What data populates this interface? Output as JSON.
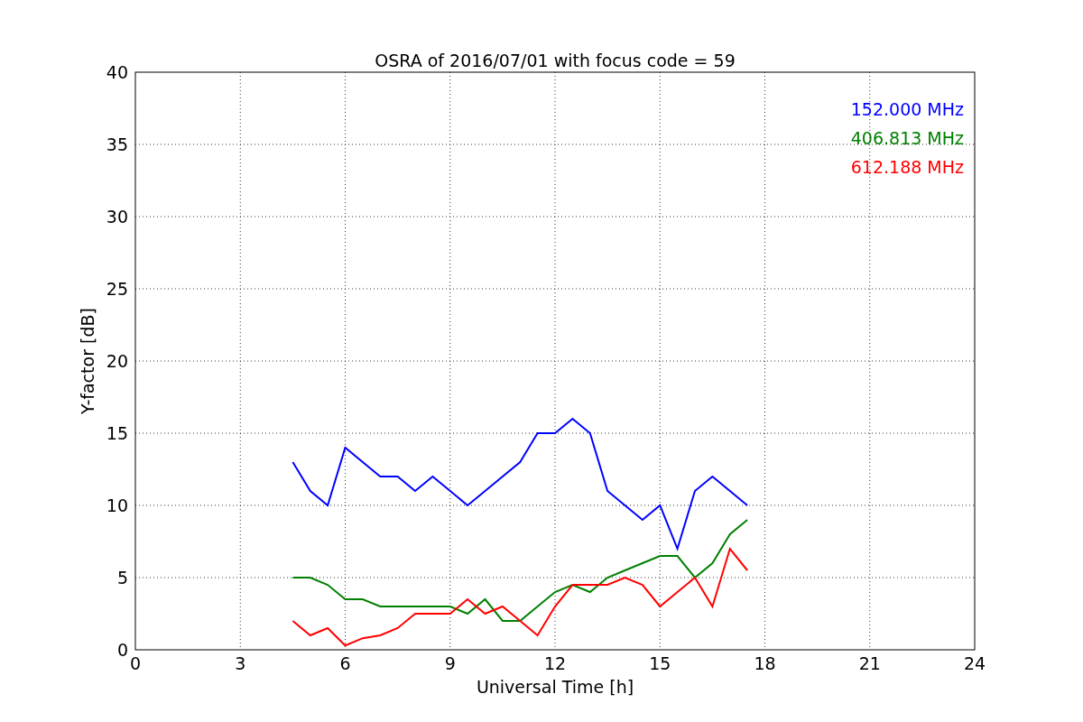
{
  "chart_data": {
    "type": "line",
    "title": "OSRA of 2016/07/01 with focus code = 59",
    "xlabel": "Universal Time [h]",
    "ylabel": "Y-factor [dB]",
    "x": [
      4.5,
      5,
      5.5,
      6,
      6.5,
      7,
      7.5,
      8,
      8.5,
      9,
      9.5,
      10,
      10.5,
      11,
      11.5,
      12,
      12.5,
      13,
      13.5,
      14,
      14.5,
      15,
      15.5,
      16,
      16.5,
      17,
      17.5
    ],
    "series": [
      {
        "name": "152.000 MHz",
        "color": "#0000ff",
        "values": [
          13,
          11,
          10,
          14,
          13,
          12,
          12,
          11,
          12,
          11,
          10,
          11,
          12,
          13,
          15,
          15,
          16,
          15,
          11,
          10,
          9,
          10,
          7,
          11,
          12,
          11,
          10
        ]
      },
      {
        "name": "406.813 MHz",
        "color": "#008000",
        "values": [
          5,
          5,
          4.5,
          3.5,
          3.5,
          3,
          3,
          3,
          3,
          3,
          2.5,
          3.5,
          2,
          2,
          3,
          4,
          4.5,
          4,
          5,
          5.5,
          6,
          6.5,
          6.5,
          5,
          6,
          8,
          9
        ]
      },
      {
        "name": "612.188 MHz",
        "color": "#ff0000",
        "values": [
          2,
          1,
          1.5,
          0.3,
          0.8,
          1,
          1.5,
          2.5,
          2.5,
          2.5,
          3.5,
          2.5,
          3,
          2,
          1,
          3,
          4.5,
          4.5,
          4.5,
          5,
          4.5,
          3,
          4,
          5,
          3,
          7,
          5.5
        ]
      }
    ],
    "grid": true,
    "xlim": [
      0,
      24
    ],
    "ylim": [
      0,
      40
    ],
    "xticks": [
      0,
      3,
      6,
      9,
      12,
      15,
      18,
      21,
      24
    ],
    "yticks": [
      0,
      5,
      10,
      15,
      20,
      25,
      30,
      35,
      40
    ]
  }
}
